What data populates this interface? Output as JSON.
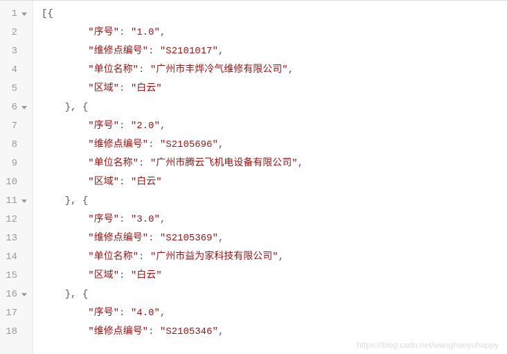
{
  "watermark": "https://blog.csdn.net/wanghaoyuhappy",
  "lines": [
    {
      "num": "1",
      "fold": true,
      "indent": 0,
      "tokens": [
        {
          "t": "punct",
          "v": "[{"
        }
      ]
    },
    {
      "num": "2",
      "fold": false,
      "indent": 2,
      "tokens": [
        {
          "t": "key",
          "v": "\"序号\""
        },
        {
          "t": "colon",
          "v": ": "
        },
        {
          "t": "str",
          "v": "\"1.0\""
        },
        {
          "t": "punct",
          "v": ","
        }
      ]
    },
    {
      "num": "3",
      "fold": false,
      "indent": 2,
      "tokens": [
        {
          "t": "key",
          "v": "\"维修点编号\""
        },
        {
          "t": "colon",
          "v": ": "
        },
        {
          "t": "str",
          "v": "\"S2101017\""
        },
        {
          "t": "punct",
          "v": ","
        }
      ]
    },
    {
      "num": "4",
      "fold": false,
      "indent": 2,
      "tokens": [
        {
          "t": "key",
          "v": "\"单位名称\""
        },
        {
          "t": "colon",
          "v": ": "
        },
        {
          "t": "str",
          "v": "\"广州市丰烨冷气维修有限公司\""
        },
        {
          "t": "punct",
          "v": ","
        }
      ]
    },
    {
      "num": "5",
      "fold": false,
      "indent": 2,
      "tokens": [
        {
          "t": "key",
          "v": "\"区域\""
        },
        {
          "t": "colon",
          "v": ": "
        },
        {
          "t": "str",
          "v": "\"白云\""
        }
      ]
    },
    {
      "num": "6",
      "fold": true,
      "indent": 1,
      "tokens": [
        {
          "t": "punct",
          "v": "}, {"
        }
      ]
    },
    {
      "num": "7",
      "fold": false,
      "indent": 2,
      "tokens": [
        {
          "t": "key",
          "v": "\"序号\""
        },
        {
          "t": "colon",
          "v": ": "
        },
        {
          "t": "str",
          "v": "\"2.0\""
        },
        {
          "t": "punct",
          "v": ","
        }
      ]
    },
    {
      "num": "8",
      "fold": false,
      "indent": 2,
      "tokens": [
        {
          "t": "key",
          "v": "\"维修点编号\""
        },
        {
          "t": "colon",
          "v": ": "
        },
        {
          "t": "str",
          "v": "\"S2105696\""
        },
        {
          "t": "punct",
          "v": ","
        }
      ]
    },
    {
      "num": "9",
      "fold": false,
      "indent": 2,
      "tokens": [
        {
          "t": "key",
          "v": "\"单位名称\""
        },
        {
          "t": "colon",
          "v": ": "
        },
        {
          "t": "str",
          "v": "\"广州市腾云飞机电设备有限公司\""
        },
        {
          "t": "punct",
          "v": ","
        }
      ]
    },
    {
      "num": "10",
      "fold": false,
      "indent": 2,
      "tokens": [
        {
          "t": "key",
          "v": "\"区域\""
        },
        {
          "t": "colon",
          "v": ": "
        },
        {
          "t": "str",
          "v": "\"白云\""
        }
      ]
    },
    {
      "num": "11",
      "fold": true,
      "indent": 1,
      "tokens": [
        {
          "t": "punct",
          "v": "}, {"
        }
      ]
    },
    {
      "num": "12",
      "fold": false,
      "indent": 2,
      "tokens": [
        {
          "t": "key",
          "v": "\"序号\""
        },
        {
          "t": "colon",
          "v": ": "
        },
        {
          "t": "str",
          "v": "\"3.0\""
        },
        {
          "t": "punct",
          "v": ","
        }
      ]
    },
    {
      "num": "13",
      "fold": false,
      "indent": 2,
      "tokens": [
        {
          "t": "key",
          "v": "\"维修点编号\""
        },
        {
          "t": "colon",
          "v": ": "
        },
        {
          "t": "str",
          "v": "\"S2105369\""
        },
        {
          "t": "punct",
          "v": ","
        }
      ]
    },
    {
      "num": "14",
      "fold": false,
      "indent": 2,
      "tokens": [
        {
          "t": "key",
          "v": "\"单位名称\""
        },
        {
          "t": "colon",
          "v": ": "
        },
        {
          "t": "str",
          "v": "\"广州市益为家科技有限公司\""
        },
        {
          "t": "punct",
          "v": ","
        }
      ]
    },
    {
      "num": "15",
      "fold": false,
      "indent": 2,
      "tokens": [
        {
          "t": "key",
          "v": "\"区域\""
        },
        {
          "t": "colon",
          "v": ": "
        },
        {
          "t": "str",
          "v": "\"白云\""
        }
      ]
    },
    {
      "num": "16",
      "fold": true,
      "indent": 1,
      "tokens": [
        {
          "t": "punct",
          "v": "}, {"
        }
      ]
    },
    {
      "num": "17",
      "fold": false,
      "indent": 2,
      "tokens": [
        {
          "t": "key",
          "v": "\"序号\""
        },
        {
          "t": "colon",
          "v": ": "
        },
        {
          "t": "str",
          "v": "\"4.0\""
        },
        {
          "t": "punct",
          "v": ","
        }
      ]
    },
    {
      "num": "18",
      "fold": false,
      "indent": 2,
      "tokens": [
        {
          "t": "key",
          "v": "\"维修点编号\""
        },
        {
          "t": "colon",
          "v": ": "
        },
        {
          "t": "str",
          "v": "\"S2105346\""
        },
        {
          "t": "punct",
          "v": ","
        }
      ]
    }
  ]
}
